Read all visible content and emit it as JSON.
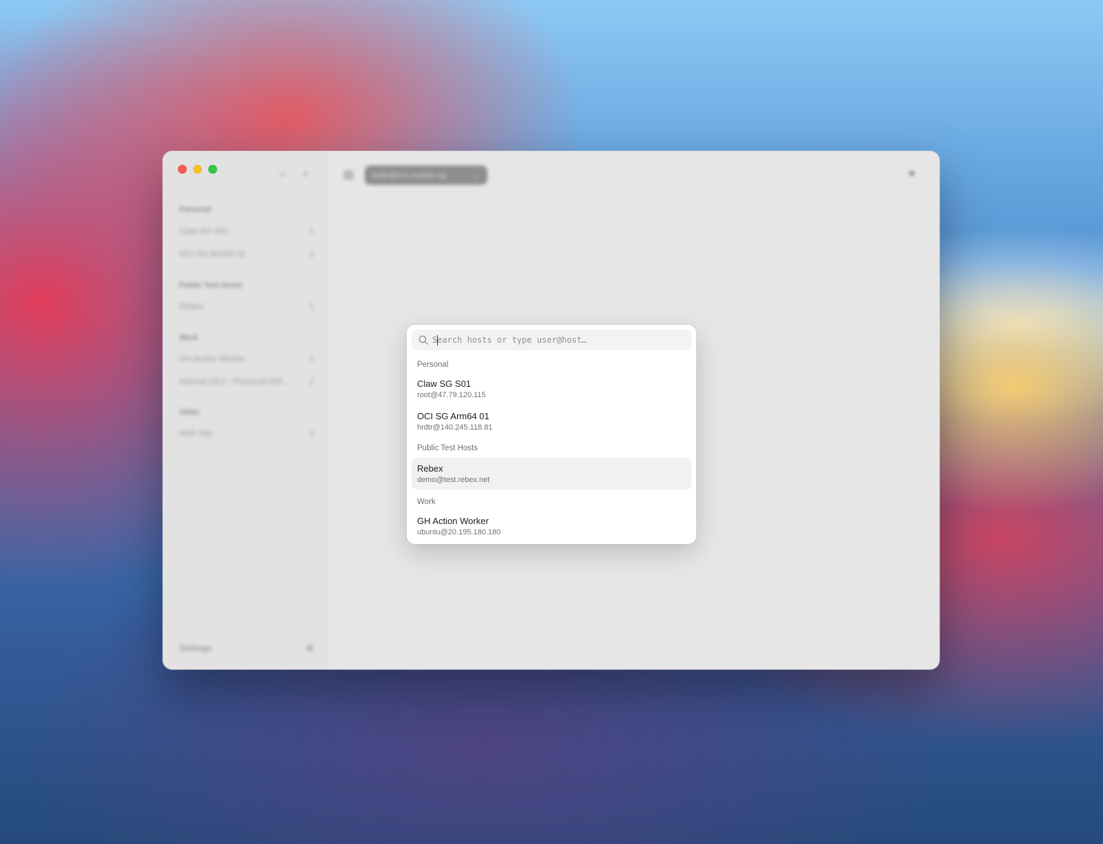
{
  "sidebar": {
    "groups": [
      {
        "title": "Personal",
        "items": [
          {
            "label": "Claw SG S01",
            "count": "1"
          },
          {
            "label": "OCI SG Arm64 01",
            "count": "1"
          }
        ]
      },
      {
        "title": "Public Test Hosts",
        "items": [
          {
            "label": "Rebex",
            "count": "1"
          }
        ]
      },
      {
        "title": "Work",
        "items": [
          {
            "label": "GH Action Worker",
            "count": "1"
          },
          {
            "label": "Internal DEV - Personal 005...",
            "count": "1"
          }
        ]
      },
      {
        "title": "Other",
        "items": [
          {
            "label": "NAS Sky",
            "count": "1"
          }
        ]
      }
    ],
    "settings_label": "Settings"
  },
  "toolbar": {
    "tab_label": "hrdtr@oci-mobile-sg"
  },
  "palette": {
    "search": {
      "placeholder": "Search hosts or type user@host…",
      "value": ""
    },
    "groups": [
      {
        "title": "Personal",
        "hosts": [
          {
            "name": "Claw SG S01",
            "address": "root@47.79.120.115",
            "selected": false
          },
          {
            "name": "OCI SG Arm64 01",
            "address": "hrdtr@140.245.118.81",
            "selected": false
          }
        ]
      },
      {
        "title": "Public Test Hosts",
        "hosts": [
          {
            "name": "Rebex",
            "address": "demo@test.rebex.net",
            "selected": true
          }
        ]
      },
      {
        "title": "Work",
        "hosts": [
          {
            "name": "GH Action Worker",
            "address": "ubuntu@20.195.180.180",
            "selected": false
          }
        ]
      }
    ]
  },
  "colors": {
    "close": "#f25c54",
    "minimize": "#f6bd2f",
    "zoom": "#33c748"
  }
}
